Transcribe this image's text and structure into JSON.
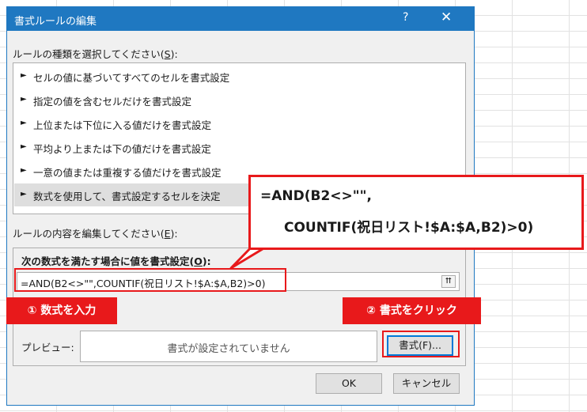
{
  "dialog": {
    "title": "書式ルールの編集",
    "help": "?",
    "close": "✕",
    "select_type_label": "ルールの種類を選択してください(",
    "select_type_key": "S",
    "select_type_suffix": "):",
    "rules": [
      "セルの値に基づいてすべてのセルを書式設定",
      "指定の値を含むセルだけを書式設定",
      "上位または下位に入る値だけを書式設定",
      "平均より上または下の値だけを書式設定",
      "一意の値または重複する値だけを書式設定",
      "数式を使用して、書式設定するセルを決定"
    ],
    "rule_arrow": "►",
    "selected_rule_index": 5,
    "edit_label": "ルールの内容を編集してください(",
    "edit_key": "E",
    "edit_suffix": "):",
    "formula_label": "次の数式を満たす場合に値を書式設定(",
    "formula_key": "O",
    "formula_suffix": "):",
    "formula_value": "=AND(B2<>\"\",COUNTIF(祝日リスト!$A:$A,B2)>0)",
    "collapse_icon": "⮅",
    "preview_label": "プレビュー:",
    "preview_text": "書式が設定されていません",
    "format_button": "書式(F)...",
    "ok_button": "OK",
    "cancel_button": "キャンセル"
  },
  "annotations": {
    "callout_line1": "=AND(B2<>\"\",",
    "callout_line2": "COUNTIF(祝日リスト!$A:$A,B2)>0)",
    "step1": "① 数式を入力",
    "step2": "② 書式をクリック",
    "accent_color": "#e8191b"
  },
  "colors": {
    "titlebar": "#1f78c1",
    "dialog_bg": "#f0f0f0"
  }
}
